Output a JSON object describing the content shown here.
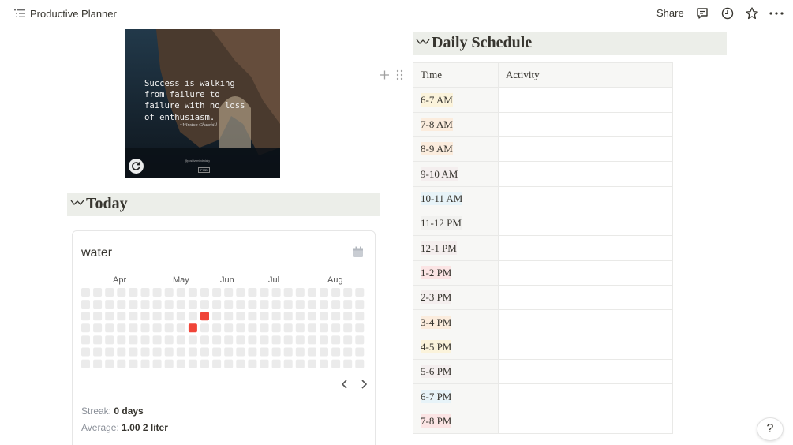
{
  "topbar": {
    "title": "Productive Planner",
    "share_label": "Share",
    "icons": [
      "page-list-icon",
      "comment-icon",
      "clock-history-icon",
      "star-icon",
      "more-icon"
    ]
  },
  "quote": {
    "text": "Success is walking\nfrom failure to\nfailure with no loss\nof enthusiasm.",
    "author": "~Winston Churchill",
    "handle": "@positivemindsdaily",
    "logo": "PMD"
  },
  "today": {
    "heading": "Today",
    "widget": {
      "title": "water",
      "months": [
        "Apr",
        "May",
        "Jun",
        "Jul",
        "Aug"
      ],
      "streak_label": "Streak:",
      "streak_value": "0 days",
      "average_label": "Average:",
      "average_value": "1.00 2 liter",
      "accent_color": "#f04438",
      "empty_color": "#ebebeb"
    }
  },
  "schedule": {
    "heading": "Daily Schedule",
    "columns": [
      "Time",
      "Activity"
    ],
    "rows": [
      {
        "time": "6-7 AM",
        "activity": "",
        "highlight": "#fbf3db"
      },
      {
        "time": "7-8 AM",
        "activity": "",
        "highlight": "#fbecdd"
      },
      {
        "time": "8-9 AM",
        "activity": "",
        "highlight": "#fbecdd"
      },
      {
        "time": "9-10 AM",
        "activity": "",
        "highlight": "#f4eeee"
      },
      {
        "time": "10-11 AM",
        "activity": "",
        "highlight": "#e7f3f8"
      },
      {
        "time": "11-12 PM",
        "activity": "",
        "highlight": "#f1f1ef"
      },
      {
        "time": "12-1 PM",
        "activity": "",
        "highlight": "#f4eeee"
      },
      {
        "time": "1-2 PM",
        "activity": "",
        "highlight": "#fbe4e4"
      },
      {
        "time": "2-3 PM",
        "activity": "",
        "highlight": "#f4eeee"
      },
      {
        "time": "3-4 PM",
        "activity": "",
        "highlight": "#fbecdd"
      },
      {
        "time": "4-5 PM",
        "activity": "",
        "highlight": "#fbf3db"
      },
      {
        "time": "5-6 PM",
        "activity": "",
        "highlight": "#f4eeee"
      },
      {
        "time": "6-7 PM",
        "activity": "",
        "highlight": "#e7f3f8"
      },
      {
        "time": "7-8 PM",
        "activity": "",
        "highlight": "#fbe4e4"
      }
    ]
  },
  "help_label": "?"
}
